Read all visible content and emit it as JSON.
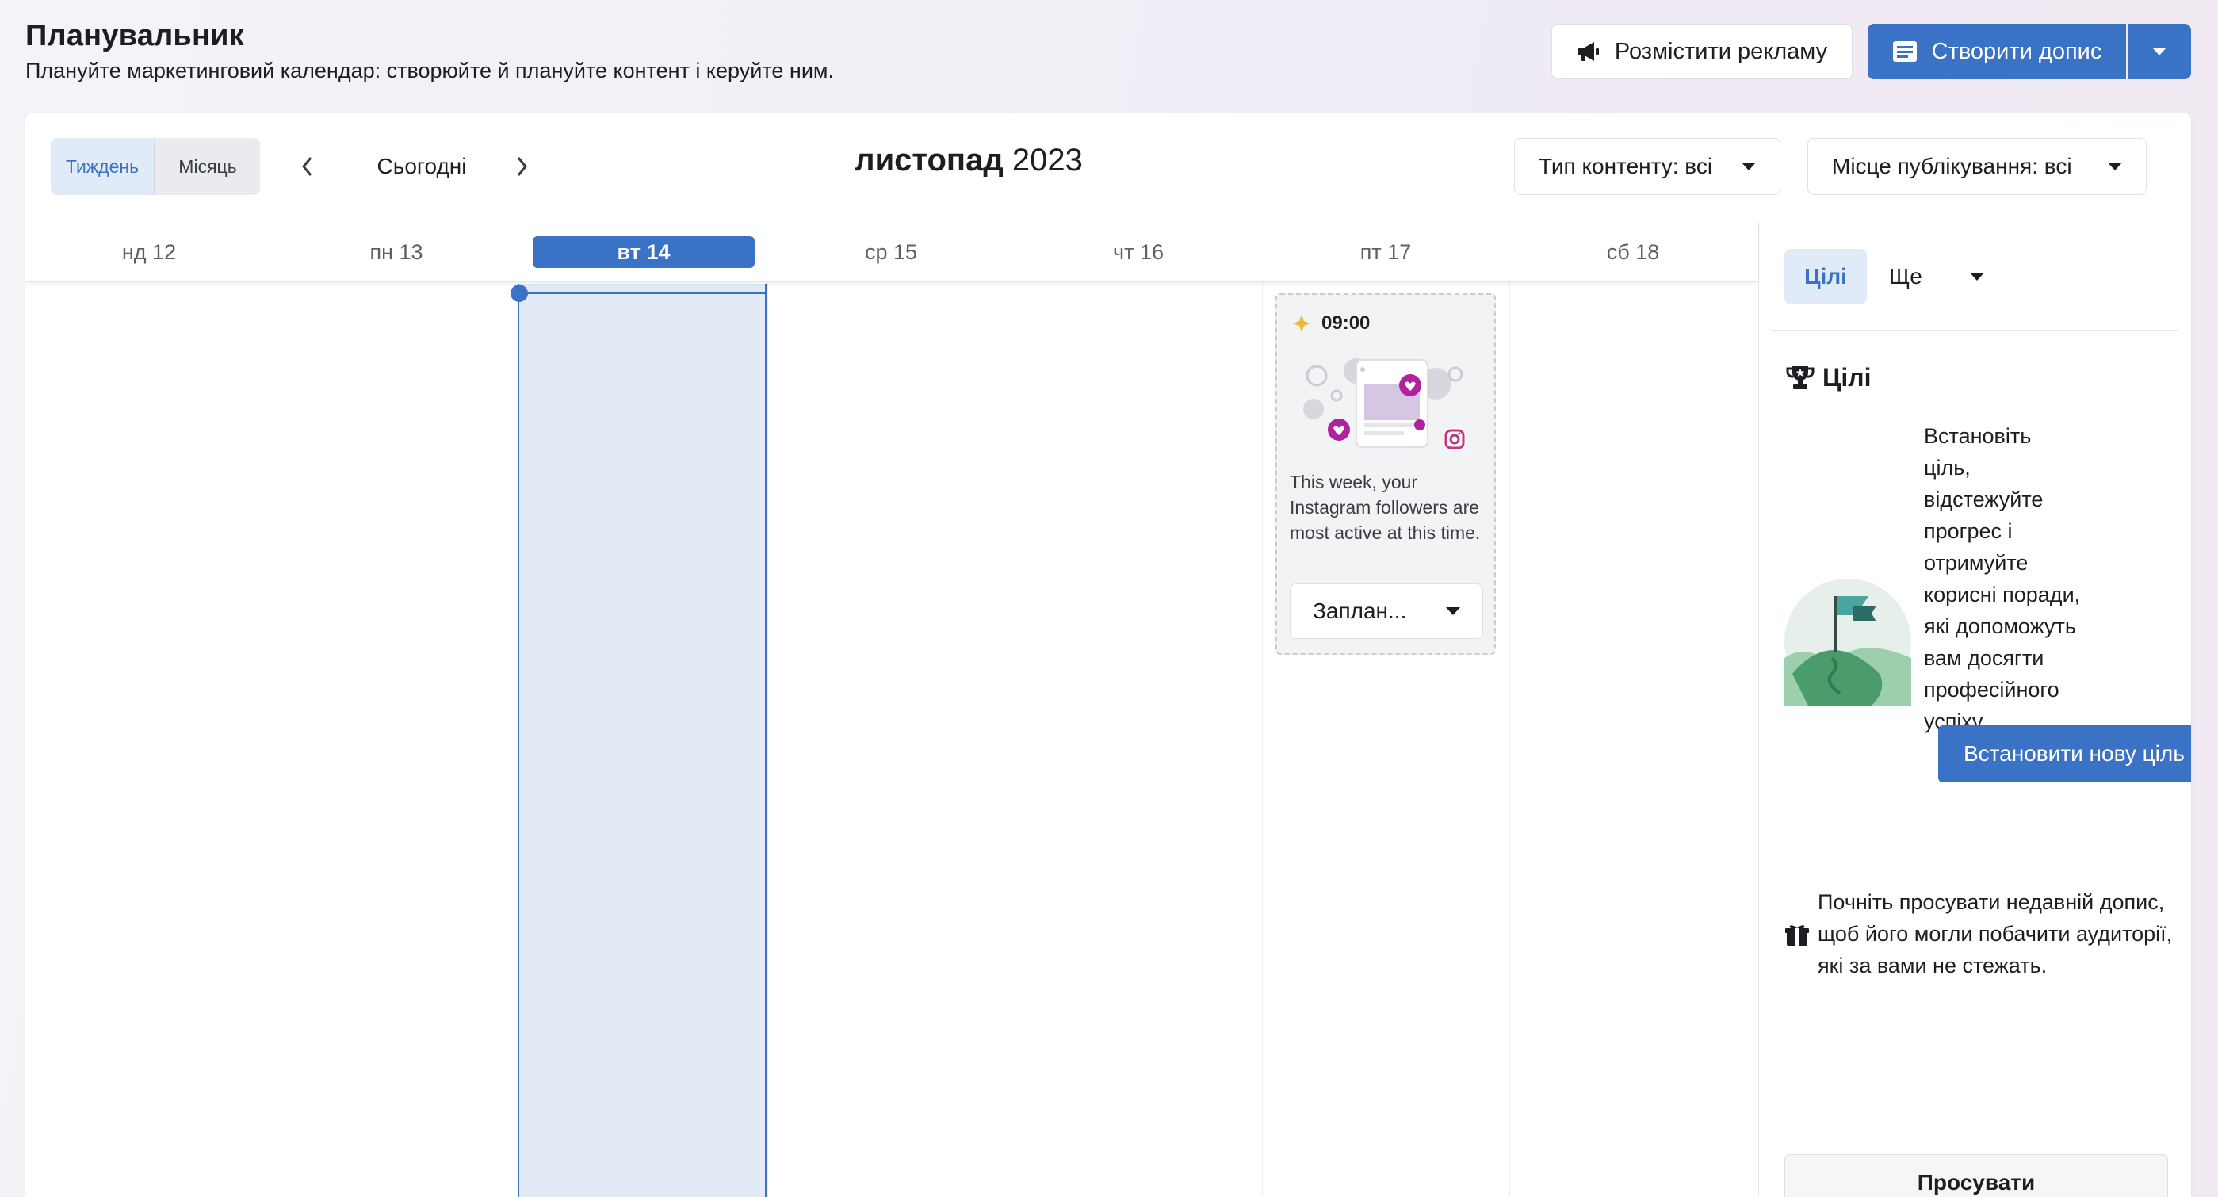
{
  "header": {
    "title": "Планувальник",
    "subtitle": "Плануйте маркетинговий календар: створюйте й плануйте контент і керуйте ним.",
    "ad_button": "Розмістити рекламу",
    "create_button": "Створити допис"
  },
  "toolbar": {
    "view_week": "Тиждень",
    "view_month": "Місяць",
    "today": "Сьогодні",
    "month_name": "листопад",
    "year": "2023",
    "filter_type": "Тип контенту: всі",
    "filter_place": "Місце публікування: всі"
  },
  "days": [
    {
      "label": "нд 12"
    },
    {
      "label": "пн 13"
    },
    {
      "label": "вт 14"
    },
    {
      "label": "ср 15"
    },
    {
      "label": "чт 16"
    },
    {
      "label": "пт 17"
    },
    {
      "label": "сб 18"
    }
  ],
  "post": {
    "time": "09:00",
    "text": "This week, your Instagram followers are most active at this time.",
    "action": "Заплан..."
  },
  "side": {
    "tab_goals": "Цілі",
    "tab_more": "Ще",
    "goals_title": "Цілі",
    "goals_text": "Встановіть ціль, відстежуйте прогрес і отримуйте корисні поради, які допоможуть вам досягти професійного успіху.",
    "goal_button": "Встановити нову ціль",
    "promo_text": "Почніть просувати недавній допис, щоб його могли побачити аудиторії, які за вами не стежать.",
    "promo_button": "Просувати"
  },
  "colors": {
    "accent": "#3a72c6",
    "today_bg": "#e2ebf5",
    "instagram": "#c13584"
  }
}
